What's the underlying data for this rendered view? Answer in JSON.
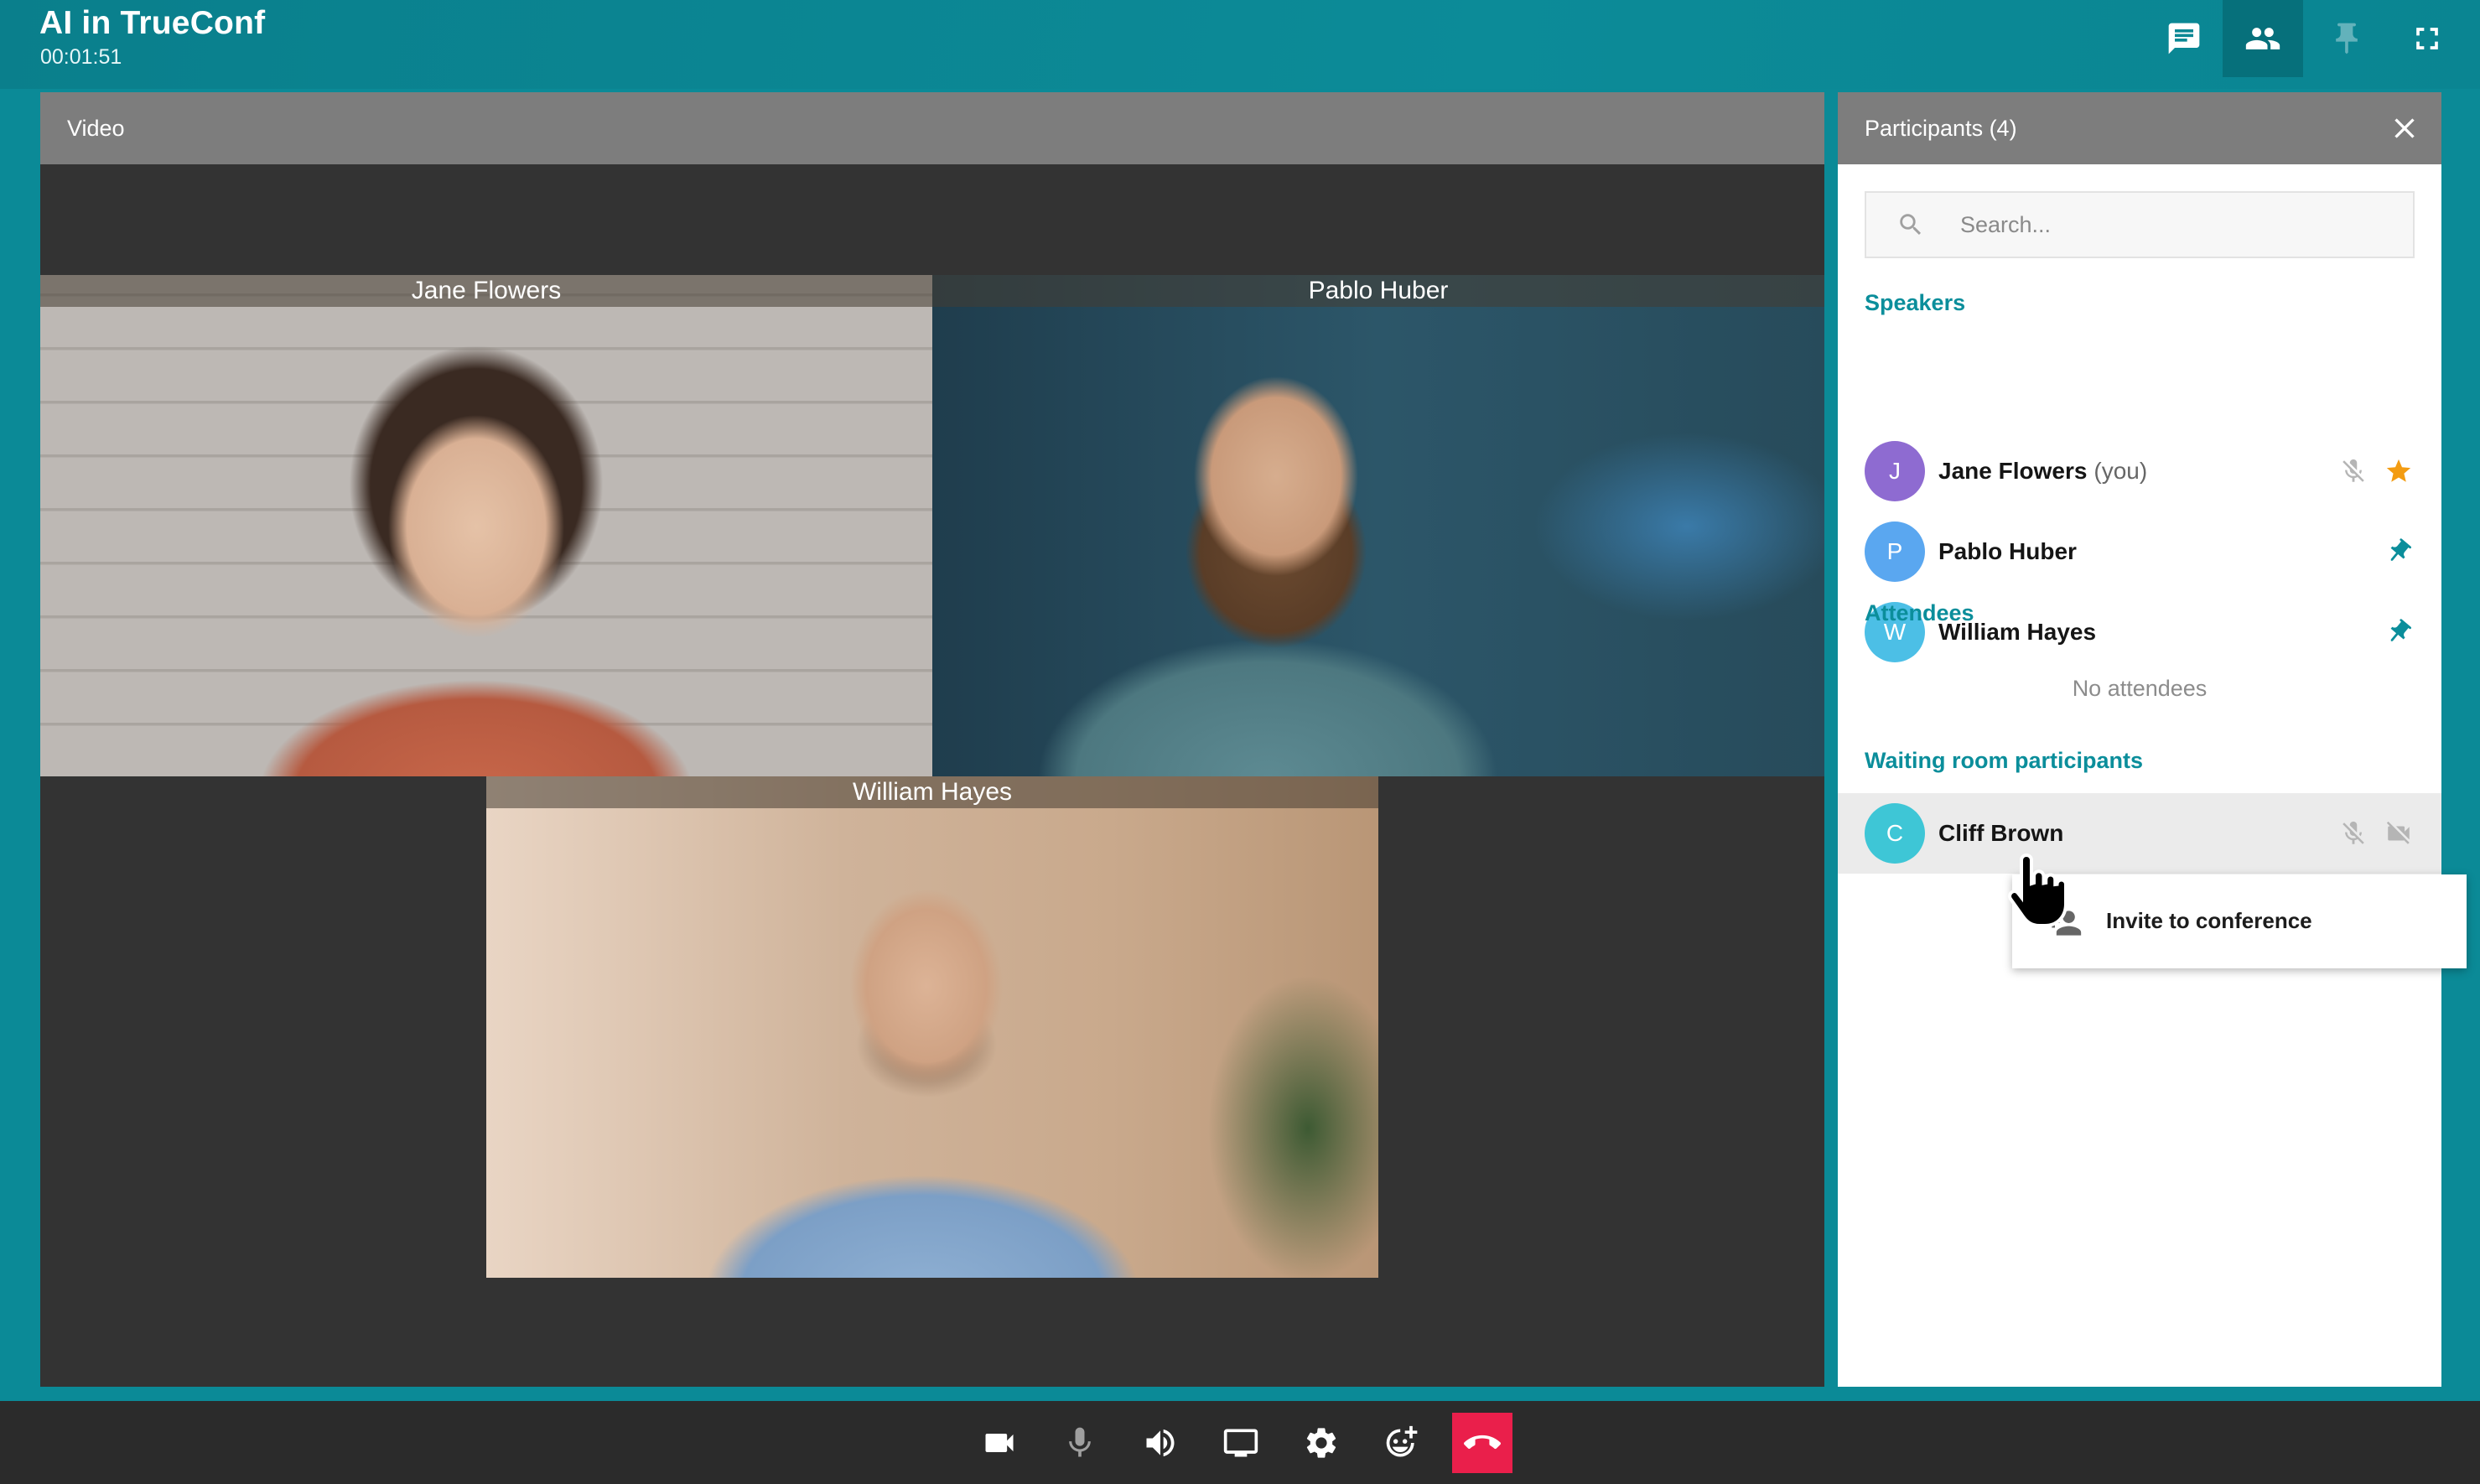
{
  "app": {
    "title": "AI in TrueConf",
    "timer": "00:01:51"
  },
  "topbar": {
    "buttons": [
      {
        "icon": "chat-icon",
        "active": false
      },
      {
        "icon": "participants-icon",
        "active": true
      },
      {
        "icon": "pin-icon",
        "active": false,
        "disabled": true
      },
      {
        "icon": "fullscreen-icon",
        "active": false
      }
    ]
  },
  "video": {
    "header": "Video",
    "tiles": [
      {
        "name": "Jane Flowers"
      },
      {
        "name": "Pablo Huber"
      },
      {
        "name": "William Hayes"
      }
    ]
  },
  "participants": {
    "header": "Participants (4)",
    "search_placeholder": "Search...",
    "speakers_title": "Speakers",
    "speakers": [
      {
        "initial": "J",
        "name": "Jane Flowers",
        "suffix": "(you)",
        "avatar_color": "#8e6bd1",
        "icons": [
          "mic-muted-icon",
          "star-icon"
        ]
      },
      {
        "initial": "P",
        "name": "Pablo Huber",
        "avatar_color": "#5aa7f0",
        "icons": [
          "pin-icon"
        ]
      },
      {
        "initial": "W",
        "name": "William Hayes",
        "avatar_color": "#4cbfe6",
        "icons": [
          "pin-icon"
        ]
      }
    ],
    "attendees_title": "Attendees",
    "no_attendees": "No attendees",
    "waiting_title": "Waiting room participants",
    "waiting": [
      {
        "initial": "C",
        "name": "Cliff Brown",
        "avatar_color": "#3ec6d6",
        "icons": [
          "mic-muted-icon",
          "camera-off-icon"
        ]
      }
    ]
  },
  "context_menu": {
    "items": [
      {
        "label": "Invite to conference",
        "icon": "add-user-icon"
      }
    ]
  },
  "toolbar": {
    "buttons": [
      "camera-icon",
      "microphone-icon",
      "speaker-icon",
      "screen-share-icon",
      "settings-icon",
      "reactions-icon",
      "hang-up-icon"
    ],
    "hangup_color": "#ea1f4b"
  },
  "colors": {
    "accent": "#0b8e9b",
    "background": "#0b8a97",
    "panel_header": "#7d7d7d",
    "star": "#f39c12"
  }
}
